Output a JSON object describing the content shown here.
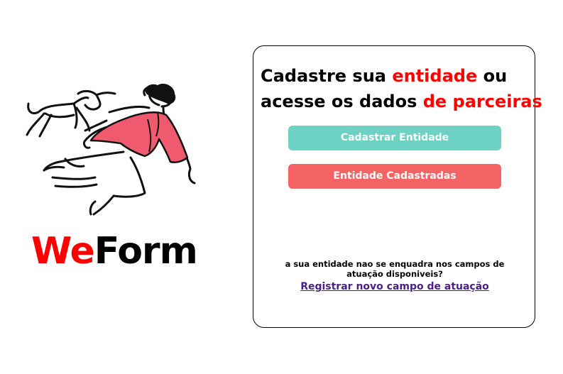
{
  "brand": {
    "logo_part1": "We",
    "logo_part2": "Form",
    "accent_color": "#ff0000"
  },
  "hero_image": {
    "icon": "running-person-with-dog-illustration",
    "accent_color": "#f05a6e"
  },
  "card": {
    "headline": {
      "line1_prefix": "Cadastre sua ",
      "line1_highlight": "entidade",
      "line1_suffix": " ou",
      "line2_prefix": "acesse os dados ",
      "line2_highlight": "de parceiras"
    },
    "buttons": {
      "register_label": "Cadastrar Entidade",
      "register_color": "#6dd1c4",
      "registered_label": "Entidade Cadastradas",
      "registered_color": "#f46464"
    },
    "footer": {
      "question": "a sua entidade nao se enquadra nos campos de atuação disponiveis?",
      "link_label": "Registrar novo campo de atuação",
      "link_color": "#4a1f86"
    }
  }
}
